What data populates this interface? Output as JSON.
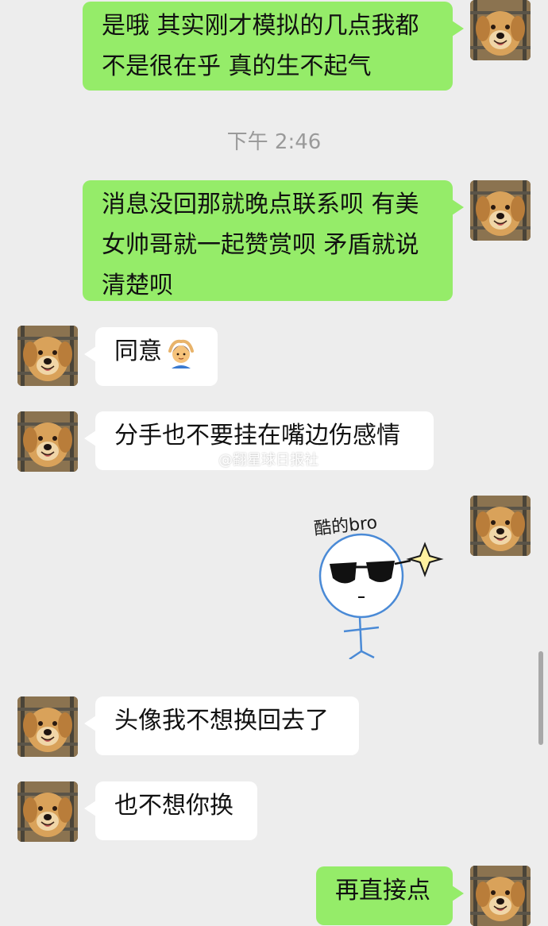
{
  "messages": {
    "m1": "是哦 其实刚才模拟的几点我都\n不是很在乎 真的生不起气",
    "m2": "消息没回那就晚点联系呗 有美\n女帅哥就一起赞赏呗 矛盾就说\n清楚呗",
    "m3": "同意",
    "m4": "分手也不要挂在嘴边伤感情",
    "m6": "头像我不想换回去了",
    "m7": "也不想你换",
    "m8": "再直接点"
  },
  "timestamp": "下午 2:46",
  "sticker": {
    "text": "酷的bro"
  },
  "watermark": "@翻星球日报社",
  "colors": {
    "background": "#ededed",
    "outgoing_bubble": "#95ec69",
    "incoming_bubble": "#ffffff",
    "timestamp": "#9a9a9a"
  },
  "icons": {
    "avatar": "golden-retriever-avatar",
    "emoji": "person-gesturing-ok-emoji"
  }
}
